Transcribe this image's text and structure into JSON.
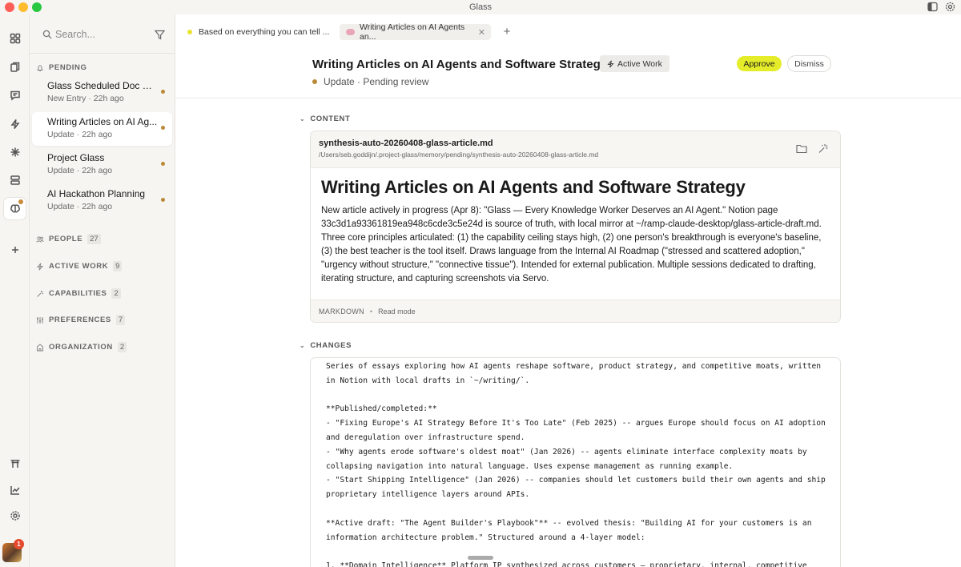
{
  "app": {
    "title": "Glass"
  },
  "rail": {
    "items": [
      "grid-icon",
      "documents-icon",
      "chat-icon",
      "bolt-icon",
      "sparkle-icon",
      "stack-icon",
      "brain-icon",
      "plus-icon"
    ],
    "bottom_items": [
      "torii-icon",
      "chart-icon",
      "settings-icon"
    ],
    "notification_count": "1"
  },
  "sidebar": {
    "search_placeholder": "Search...",
    "pending_label": "PENDING",
    "entries": [
      {
        "title": "Glass Scheduled Doc Ma...",
        "subtitle": "New Entry · 22h ago"
      },
      {
        "title": "Writing Articles on AI Ag...",
        "subtitle": "Update · 22h ago"
      },
      {
        "title": "Project Glass",
        "subtitle": "Update · 22h ago"
      },
      {
        "title": "AI Hackathon Planning",
        "subtitle": "Update · 22h ago"
      }
    ],
    "sections": [
      {
        "label": "PEOPLE",
        "count": "27"
      },
      {
        "label": "ACTIVE WORK",
        "count": "9"
      },
      {
        "label": "CAPABILITIES",
        "count": "2"
      },
      {
        "label": "PREFERENCES",
        "count": "7"
      },
      {
        "label": "ORGANIZATION",
        "count": "2"
      }
    ]
  },
  "tabs": [
    {
      "label": "Based on everything you can tell ..."
    },
    {
      "label": "Writing Articles on AI Agents an..."
    }
  ],
  "header": {
    "title": "Writing Articles on AI Agents and Software Strategy",
    "tag": "Active Work",
    "meta": "Update · Pending review",
    "approve": "Approve",
    "dismiss": "Dismiss"
  },
  "content": {
    "label": "CONTENT",
    "file_name": "synthesis-auto-20260408-glass-article.md",
    "file_path": "/Users/seb.goddijn/.project-glass/memory/pending/synthesis-auto-20260408-glass-article.md",
    "heading": "Writing Articles on AI Agents and Software Strategy",
    "body": "New article actively in progress (Apr 8): \"Glass — Every Knowledge Worker Deserves an AI Agent.\" Notion page 33c3d1a93361819ea948c6cde3c5e24d is source of truth, with local mirror at ~/ramp-claude-desktop/glass-article-draft.md. Three core principles articulated: (1) the capability ceiling stays high, (2) one person's breakthrough is everyone's baseline, (3) the best teacher is the tool itself. Draws language from the Internal AI Roadmap (\"stressed and scattered adoption,\" \"urgency without structure,\" \"connective tissue\"). Intended for external publication. Multiple sessions dedicated to drafting, iterating structure, and capturing screenshots via Servo.",
    "format": "MARKDOWN",
    "mode": "Read mode"
  },
  "changes": {
    "label": "CHANGES",
    "text": "Series of essays exploring how AI agents reshape software, product strategy, and competitive moats, written\nin Notion with local drafts in `~/writing/`.\n\n**Published/completed:**\n- \"Fixing Europe's AI Strategy Before It's Too Late\" (Feb 2025) -- argues Europe should focus on AI adoption\nand deregulation over infrastructure spend.\n- \"Why agents erode software's oldest moat\" (Jan 2026) -- agents eliminate interface complexity moats by\ncollapsing navigation into natural language. Uses expense management as running example.\n- \"Start Shipping Intelligence\" (Jan 2026) -- companies should let customers build their own agents and ship\nproprietary intelligence layers around APIs.\n\n**Active draft: \"The Agent Builder's Playbook\"** -- evolved thesis: \"Building AI for your customers is an\ninformation architecture problem.\" Structured around a 4-layer model:\n\n1. **Domain Intelligence** Platform IP synthesized across customers — proprietary, internal, competitive"
  }
}
